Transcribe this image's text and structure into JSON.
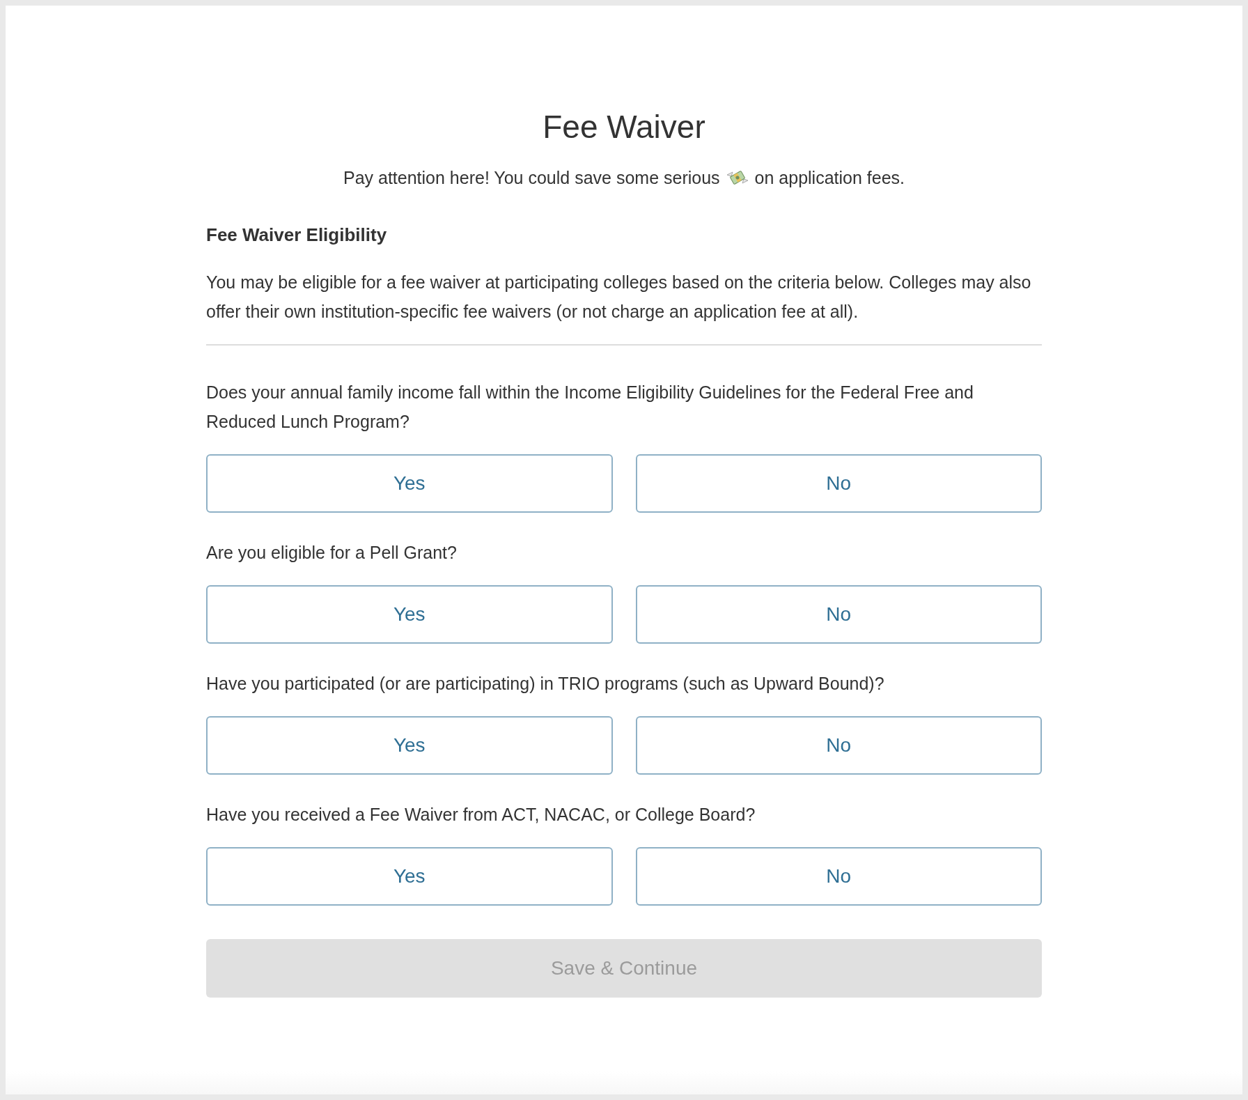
{
  "title": "Fee Waiver",
  "intro": {
    "before": "Pay attention here! You could save some serious",
    "after": "on application fees."
  },
  "section": {
    "heading": "Fee Waiver Eligibility",
    "description": "You may be eligible for a fee waiver at participating colleges based on the criteria below. Colleges may also offer their own institution-specific fee waivers (or not charge an application fee at all)."
  },
  "questions": [
    {
      "text": "Does your annual family income fall within the Income Eligibility Guidelines for the Federal Free and Reduced Lunch Program?",
      "options": [
        {
          "label": "Yes",
          "selected": false
        },
        {
          "label": "No",
          "selected": false
        }
      ]
    },
    {
      "text": "Are you eligible for a Pell Grant?",
      "options": [
        {
          "label": "Yes",
          "selected": false
        },
        {
          "label": "No",
          "selected": false
        }
      ]
    },
    {
      "text": "Have you participated (or are participating) in TRIO programs (such as Upward Bound)?",
      "options": [
        {
          "label": "Yes",
          "selected": false
        },
        {
          "label": "No",
          "selected": false
        }
      ]
    },
    {
      "text": "Have you received a Fee Waiver from ACT, NACAC, or College Board?",
      "options": [
        {
          "label": "Yes",
          "selected": false
        },
        {
          "label": "No",
          "selected": false
        }
      ]
    }
  ],
  "submit": {
    "label": "Save & Continue",
    "disabled": true
  }
}
